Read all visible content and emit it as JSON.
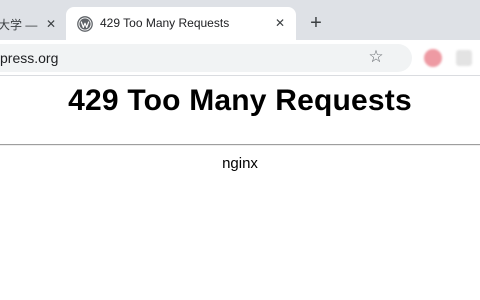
{
  "browser": {
    "tabs": [
      {
        "title": "大学 —",
        "active": false
      },
      {
        "title": "429 Too Many Requests",
        "active": true,
        "favicon": "wordpress-icon"
      }
    ],
    "close_glyph": "✕",
    "new_tab_glyph": "+",
    "url": "press.org",
    "bookmark_glyph": "☆"
  },
  "page": {
    "heading": "429 Too Many Requests",
    "server": "nginx"
  },
  "colors": {
    "tabstrip_bg": "#dee1e6",
    "omnibox_bg": "#f1f3f4"
  }
}
